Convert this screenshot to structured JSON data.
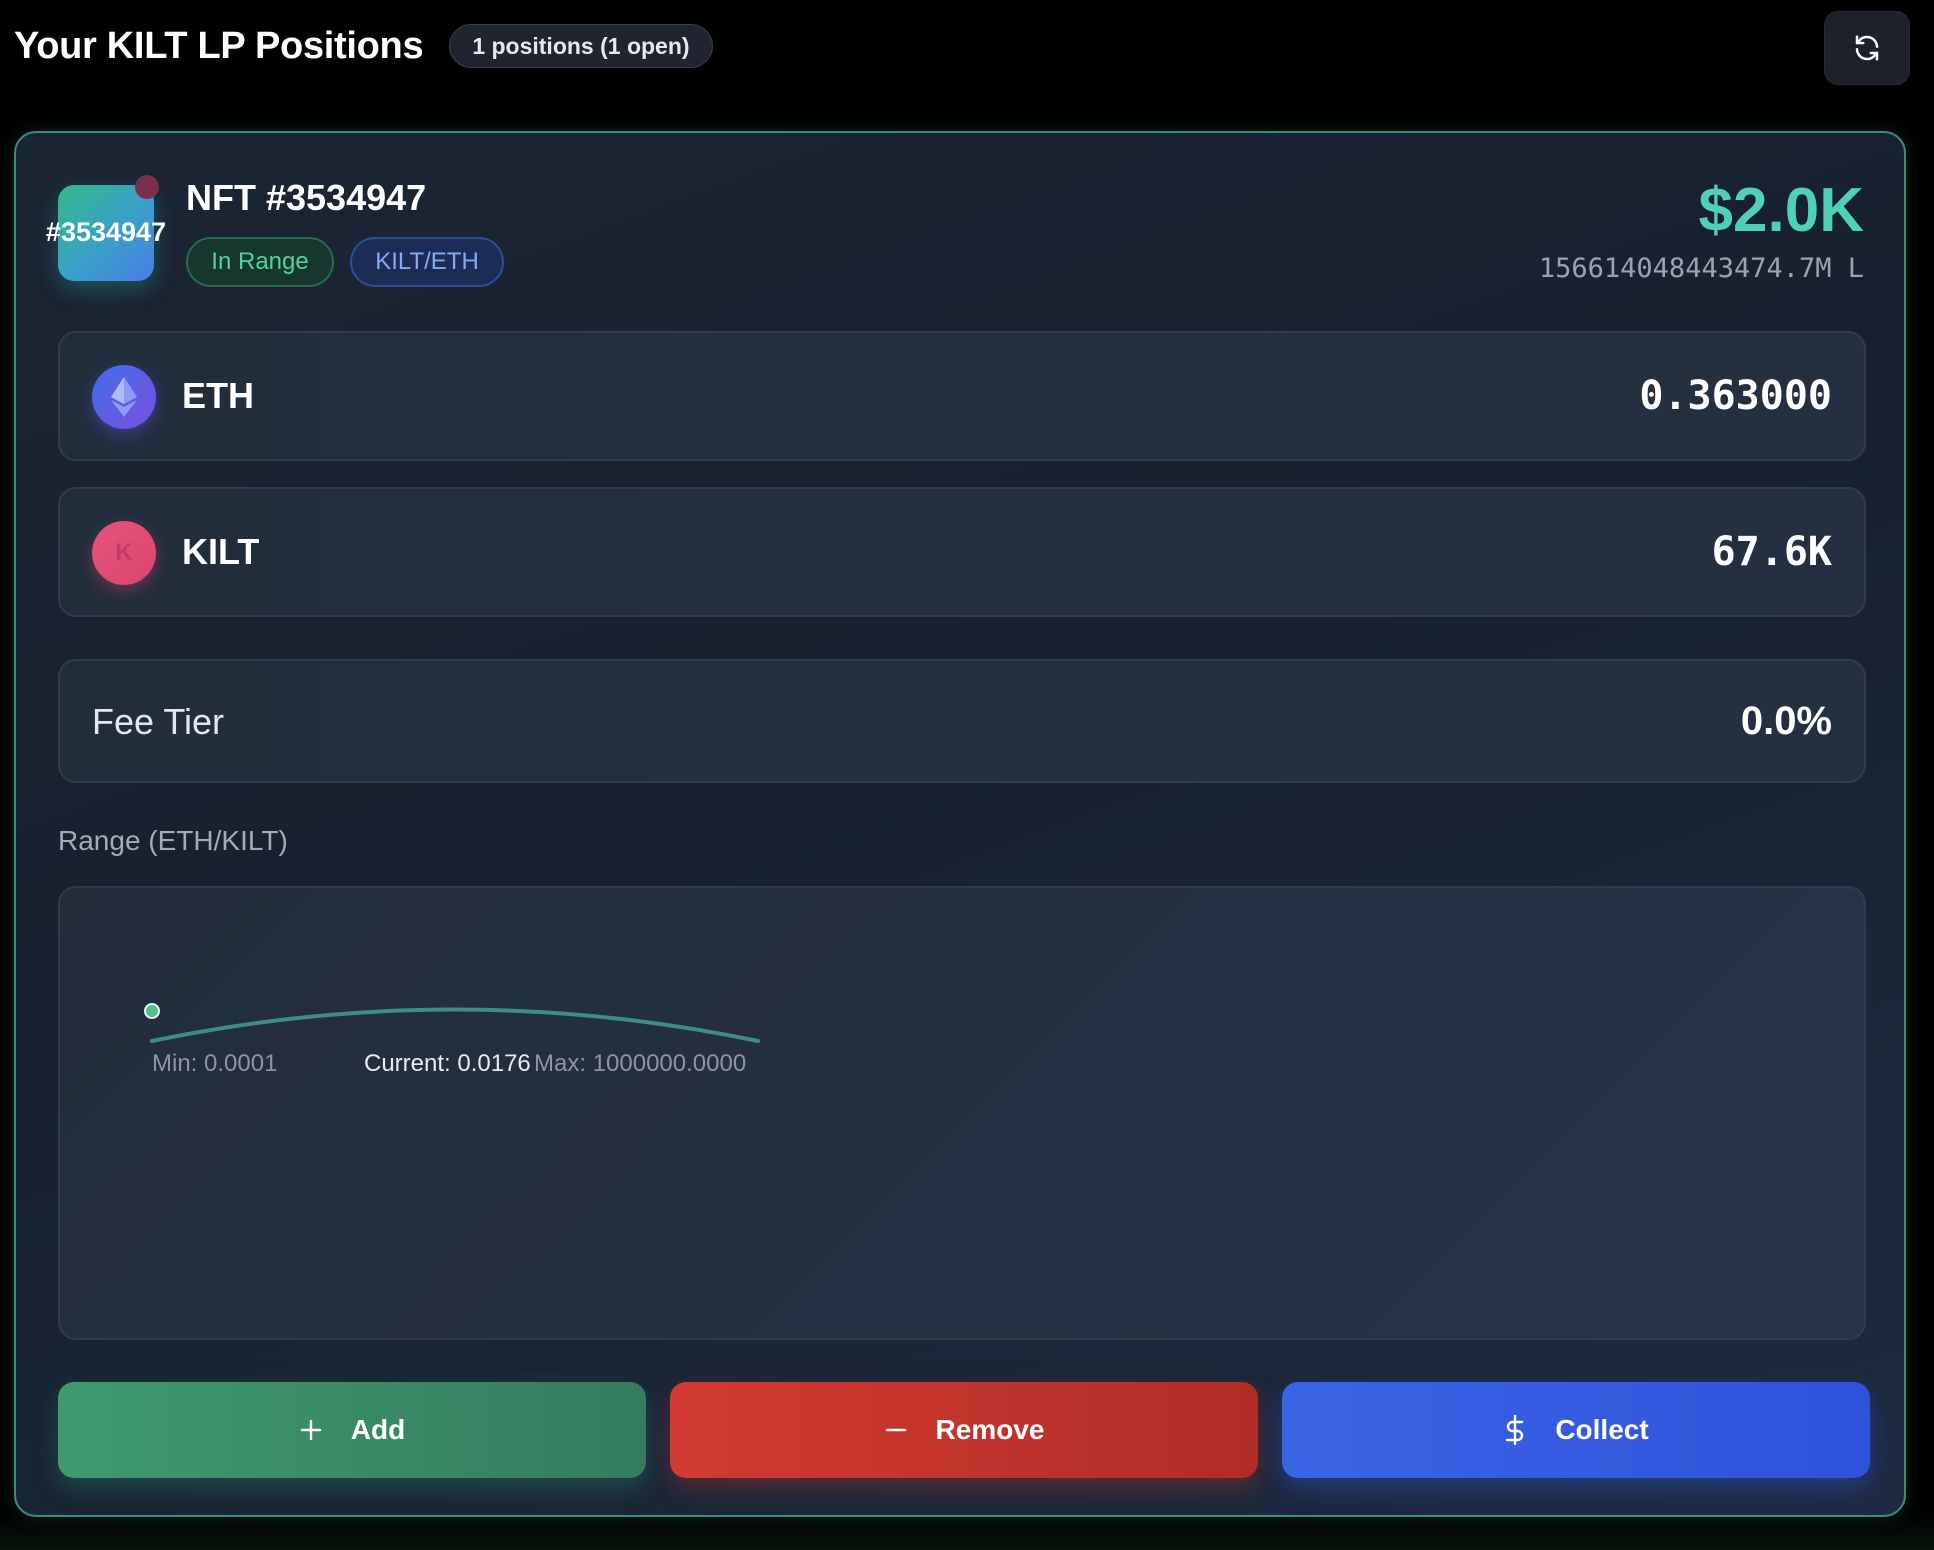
{
  "header": {
    "title": "Your KILT LP Positions",
    "count_badge": "1 positions (1 open)"
  },
  "position": {
    "nft_icon_label": "#3534947",
    "nft_title": "NFT #3534947",
    "status_pill": "In Range",
    "pair_pill": "KILT/ETH",
    "value_usd": "$2.0K",
    "liquidity": "156614048443474.7M L",
    "tokens": [
      {
        "symbol": "ETH",
        "amount": "0.363000",
        "icon": "ethereum-icon"
      },
      {
        "symbol": "KILT",
        "amount": "67.6K",
        "icon": "kilt-icon",
        "icon_glyph": "K"
      }
    ],
    "fee_tier_label": "Fee Tier",
    "fee_tier_value": "0.0%",
    "range_label": "Range (ETH/KILT)",
    "range": {
      "min_label": "Min: 0.0001",
      "current_label": "Current: 0.0176",
      "max_label": "Max: 1000000.0000",
      "min": 0.0001,
      "current": 0.0176,
      "max": 1000000.0
    }
  },
  "actions": {
    "add_label": "Add",
    "remove_label": "Remove",
    "collect_label": "Collect"
  },
  "colors": {
    "accent_teal": "#4fd1b8",
    "card_border": "#3e8d7b",
    "add": "#3f9a6e",
    "remove": "#d33a32",
    "collect": "#3a64e6",
    "in_range": "#52d39a"
  }
}
